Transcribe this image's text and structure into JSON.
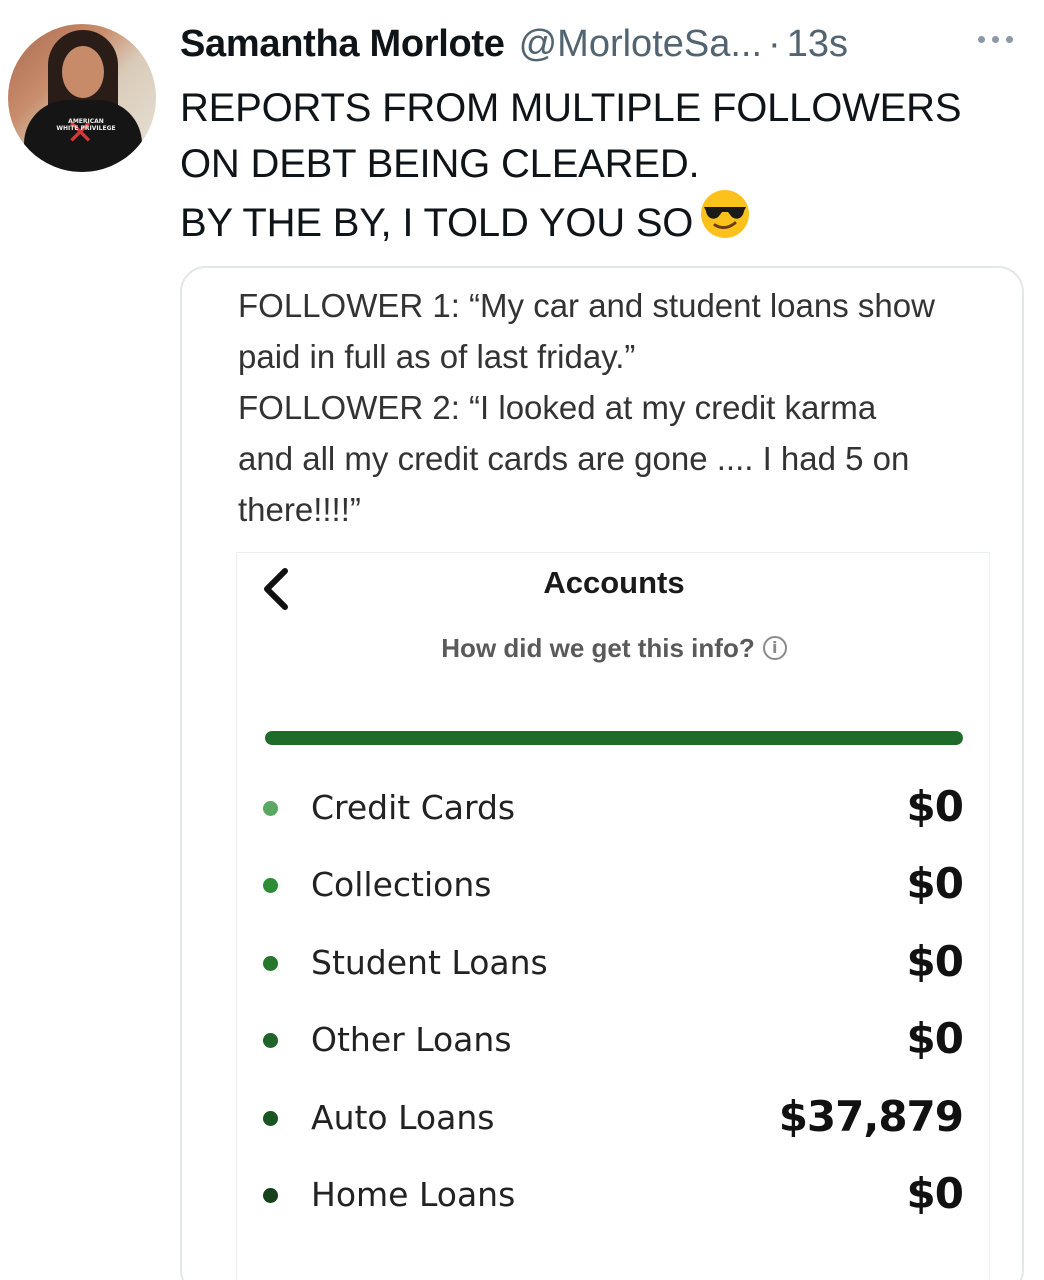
{
  "tweet": {
    "author_name": "Samantha Morlote",
    "handle": "@MorloteSa...",
    "separator": "·",
    "time": "13s",
    "lines": [
      "REPORTS FROM MULTIPLE FOLLOWERS",
      "ON DEBT BEING CLEARED.",
      "BY THE BY, I TOLD YOU SO"
    ],
    "emoji": "smiling-face-with-sunglasses",
    "avatar_shirt_text": "AMERICAN WHITE PRIVILEGE"
  },
  "quote": {
    "lines": [
      "FOLLOWER 1: “My car and student loans show",
      "paid in full as of last friday.”",
      "FOLLOWER 2: “I looked at my credit karma",
      "and all my credit cards are gone .... I had 5 on",
      "there!!!!”"
    ]
  },
  "accounts_screen": {
    "title": "Accounts",
    "info_link": "How did we get this info?",
    "info_icon": "i",
    "progress_fraction": 1.0,
    "progress_color": "#1f6b29",
    "items": [
      {
        "label": "Credit Cards",
        "value": "$0",
        "bullet_color": "#5aa862"
      },
      {
        "label": "Collections",
        "value": "$0",
        "bullet_color": "#2e8b36"
      },
      {
        "label": "Student Loans",
        "value": "$0",
        "bullet_color": "#27762f"
      },
      {
        "label": "Other Loans",
        "value": "$0",
        "bullet_color": "#1f6428"
      },
      {
        "label": "Auto Loans",
        "value": "$37,879",
        "bullet_color": "#1a5521"
      },
      {
        "label": "Home Loans",
        "value": "$0",
        "bullet_color": "#15421b"
      }
    ]
  }
}
